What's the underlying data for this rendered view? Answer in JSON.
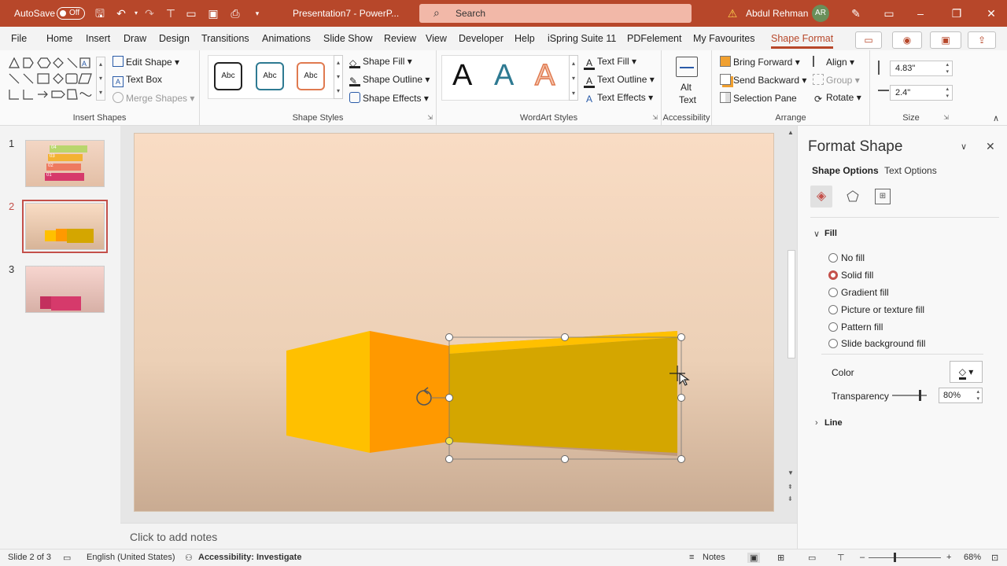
{
  "titlebar": {
    "autosave_label": "AutoSave",
    "autosave_state": "Off",
    "doc_title": "Presentation7 - PowerP...",
    "search_placeholder": "Search",
    "warning_icon": "warning-icon",
    "user_name": "Abdul Rehman",
    "user_initials": "AR",
    "color": "#b7472a"
  },
  "tabs": [
    "File",
    "Home",
    "Insert",
    "Draw",
    "Design",
    "Transitions",
    "Animations",
    "Slide Show",
    "Review",
    "View",
    "Developer",
    "Help",
    "iSpring Suite 11",
    "PDFelement",
    "My Favourites",
    "Shape Format"
  ],
  "active_tab": "Shape Format",
  "ribbon": {
    "insert_shapes": {
      "label": "Insert Shapes",
      "edit_shape": "Edit Shape",
      "text_box": "Text Box",
      "merge_shapes": "Merge Shapes"
    },
    "shape_styles": {
      "label": "Shape Styles",
      "style_label": "Abc",
      "style_colors": [
        "#222222",
        "#2e7a92",
        "#e07a50"
      ],
      "shape_fill": "Shape Fill",
      "shape_outline": "Shape Outline",
      "shape_effects": "Shape Effects"
    },
    "wordart": {
      "label": "WordArt Styles",
      "letter": "A",
      "text_fill": "Text Fill",
      "text_outline": "Text Outline",
      "text_effects": "Text Effects"
    },
    "accessibility": {
      "label": "Accessibility",
      "alt_text_1": "Alt",
      "alt_text_2": "Text"
    },
    "arrange": {
      "label": "Arrange",
      "bring_forward": "Bring Forward",
      "send_backward": "Send Backward",
      "selection_pane": "Selection Pane",
      "align": "Align",
      "group": "Group",
      "rotate": "Rotate"
    },
    "size": {
      "label": "Size",
      "height": "4.83\"",
      "width": "2.4\""
    }
  },
  "thumbnails": [
    {
      "num": "1",
      "labels": [
        "04",
        "03",
        "02",
        "01"
      ]
    },
    {
      "num": "2"
    },
    {
      "num": "3"
    }
  ],
  "notes_placeholder": "Click to add notes",
  "format_pane": {
    "title": "Format Shape",
    "tab_shape": "Shape Options",
    "tab_text": "Text Options",
    "fill_heading": "Fill",
    "options": [
      "No fill",
      "Solid fill",
      "Gradient fill",
      "Picture or texture fill",
      "Pattern fill",
      "Slide background fill"
    ],
    "selected_option": "Solid fill",
    "color_label": "Color",
    "transparency_label": "Transparency",
    "transparency_value": "80%",
    "transparency_fraction": 0.8,
    "line_heading": "Line"
  },
  "status": {
    "slide": "Slide 2 of 3",
    "language": "English (United States)",
    "accessibility": "Accessibility: Investigate",
    "notes": "Notes",
    "zoom": "68%"
  },
  "colors": {
    "yellow": "#ffc000",
    "orange": "#ff9900",
    "selected_fill": "#d4a600",
    "accent": "#c4504a"
  }
}
